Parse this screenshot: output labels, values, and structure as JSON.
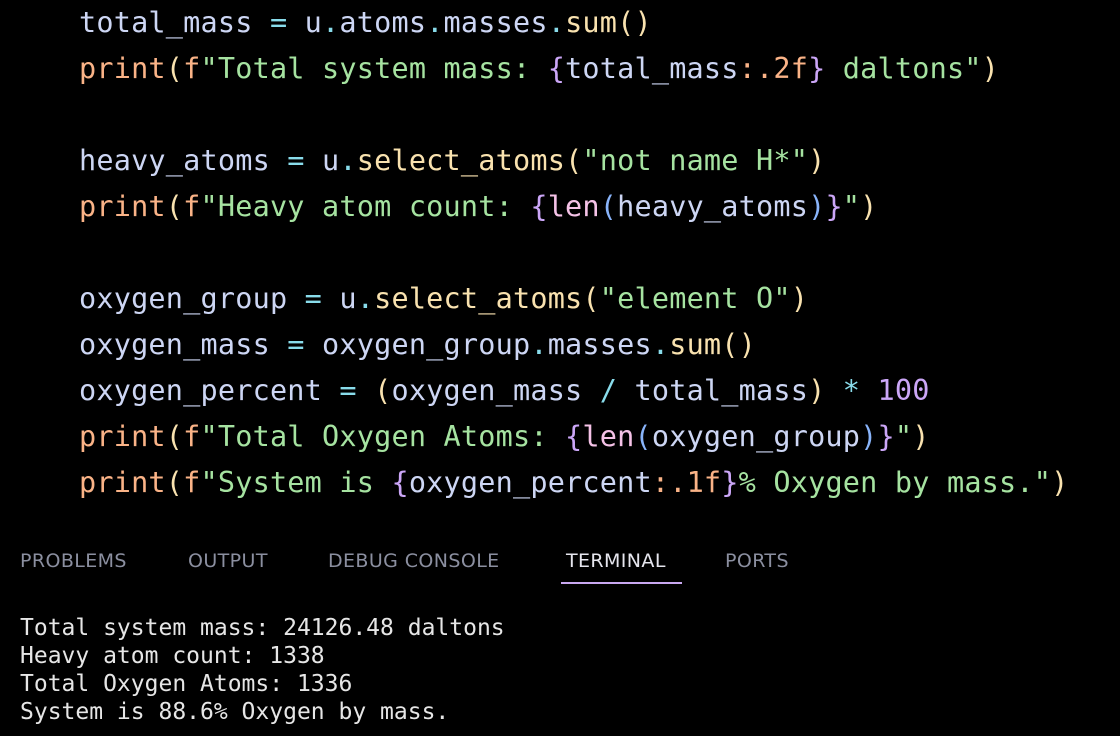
{
  "editor": {
    "lines": [
      {
        "tokens": [
          {
            "t": "total_mass",
            "c": "var"
          },
          {
            "t": " = ",
            "c": "op"
          },
          {
            "t": "u",
            "c": "var"
          },
          {
            "t": ".",
            "c": "op"
          },
          {
            "t": "atoms",
            "c": "var"
          },
          {
            "t": ".",
            "c": "op"
          },
          {
            "t": "masses",
            "c": "var"
          },
          {
            "t": ".",
            "c": "op"
          },
          {
            "t": "sum",
            "c": "fn"
          },
          {
            "t": "()",
            "c": "paren"
          }
        ]
      },
      {
        "tokens": [
          {
            "t": "print",
            "c": "builtin"
          },
          {
            "t": "(",
            "c": "paren"
          },
          {
            "t": "f",
            "c": "builtin"
          },
          {
            "t": "\"Total system mass: ",
            "c": "str"
          },
          {
            "t": "{",
            "c": "brace"
          },
          {
            "t": "total_mass",
            "c": "var"
          },
          {
            "t": ":.2f",
            "c": "builtin"
          },
          {
            "t": "}",
            "c": "brace"
          },
          {
            "t": " daltons\"",
            "c": "str"
          },
          {
            "t": ")",
            "c": "paren"
          }
        ]
      },
      {
        "tokens": []
      },
      {
        "tokens": [
          {
            "t": "heavy_atoms",
            "c": "var"
          },
          {
            "t": " = ",
            "c": "op"
          },
          {
            "t": "u",
            "c": "var"
          },
          {
            "t": ".",
            "c": "op"
          },
          {
            "t": "select_atoms",
            "c": "fn"
          },
          {
            "t": "(",
            "c": "paren"
          },
          {
            "t": "\"not name H*\"",
            "c": "str"
          },
          {
            "t": ")",
            "c": "paren"
          }
        ]
      },
      {
        "tokens": [
          {
            "t": "print",
            "c": "builtin"
          },
          {
            "t": "(",
            "c": "paren"
          },
          {
            "t": "f",
            "c": "builtin"
          },
          {
            "t": "\"Heavy atom count: ",
            "c": "str"
          },
          {
            "t": "{",
            "c": "brace"
          },
          {
            "t": "len",
            "c": "len"
          },
          {
            "t": "(",
            "c": "paren2"
          },
          {
            "t": "heavy_atoms",
            "c": "var"
          },
          {
            "t": ")",
            "c": "paren2"
          },
          {
            "t": "}",
            "c": "brace"
          },
          {
            "t": "\"",
            "c": "str"
          },
          {
            "t": ")",
            "c": "paren"
          }
        ]
      },
      {
        "tokens": []
      },
      {
        "tokens": [
          {
            "t": "oxygen_group",
            "c": "var"
          },
          {
            "t": " = ",
            "c": "op"
          },
          {
            "t": "u",
            "c": "var"
          },
          {
            "t": ".",
            "c": "op"
          },
          {
            "t": "select_atoms",
            "c": "fn"
          },
          {
            "t": "(",
            "c": "paren"
          },
          {
            "t": "\"element O\"",
            "c": "str"
          },
          {
            "t": ")",
            "c": "paren"
          }
        ]
      },
      {
        "tokens": [
          {
            "t": "oxygen_mass",
            "c": "var"
          },
          {
            "t": " = ",
            "c": "op"
          },
          {
            "t": "oxygen_group",
            "c": "var"
          },
          {
            "t": ".",
            "c": "op"
          },
          {
            "t": "masses",
            "c": "var"
          },
          {
            "t": ".",
            "c": "op"
          },
          {
            "t": "sum",
            "c": "fn"
          },
          {
            "t": "()",
            "c": "paren"
          }
        ]
      },
      {
        "tokens": [
          {
            "t": "oxygen_percent",
            "c": "var"
          },
          {
            "t": " = ",
            "c": "op"
          },
          {
            "t": "(",
            "c": "paren"
          },
          {
            "t": "oxygen_mass",
            "c": "var"
          },
          {
            "t": " / ",
            "c": "op"
          },
          {
            "t": "total_mass",
            "c": "var"
          },
          {
            "t": ")",
            "c": "paren"
          },
          {
            "t": " * ",
            "c": "op"
          },
          {
            "t": "100",
            "c": "num"
          }
        ]
      },
      {
        "tokens": [
          {
            "t": "print",
            "c": "builtin"
          },
          {
            "t": "(",
            "c": "paren"
          },
          {
            "t": "f",
            "c": "builtin"
          },
          {
            "t": "\"Total Oxygen Atoms: ",
            "c": "str"
          },
          {
            "t": "{",
            "c": "brace"
          },
          {
            "t": "len",
            "c": "len"
          },
          {
            "t": "(",
            "c": "paren2"
          },
          {
            "t": "oxygen_group",
            "c": "var"
          },
          {
            "t": ")",
            "c": "paren2"
          },
          {
            "t": "}",
            "c": "brace"
          },
          {
            "t": "\"",
            "c": "str"
          },
          {
            "t": ")",
            "c": "paren"
          }
        ]
      },
      {
        "tokens": [
          {
            "t": "print",
            "c": "builtin"
          },
          {
            "t": "(",
            "c": "paren"
          },
          {
            "t": "f",
            "c": "builtin"
          },
          {
            "t": "\"System is ",
            "c": "str"
          },
          {
            "t": "{",
            "c": "brace"
          },
          {
            "t": "oxygen_percent",
            "c": "var"
          },
          {
            "t": ":.1f",
            "c": "builtin"
          },
          {
            "t": "}",
            "c": "brace"
          },
          {
            "t": "% Oxygen by mass.\"",
            "c": "str"
          },
          {
            "t": ")",
            "c": "paren"
          }
        ]
      }
    ]
  },
  "panel": {
    "tabs": [
      {
        "label": "PROBLEMS",
        "active": false
      },
      {
        "label": "OUTPUT",
        "active": false
      },
      {
        "label": "DEBUG CONSOLE",
        "active": false
      },
      {
        "label": "TERMINAL",
        "active": true
      },
      {
        "label": "PORTS",
        "active": false
      }
    ]
  },
  "terminal": {
    "lines": [
      "Total system mass: 24126.48 daltons",
      "Heavy atom count: 1338",
      "Total Oxygen Atoms: 1336",
      "System is 88.6% Oxygen by mass."
    ]
  },
  "colors": {
    "background": "#000000",
    "active_tab_underline": "#c9a8f0"
  }
}
